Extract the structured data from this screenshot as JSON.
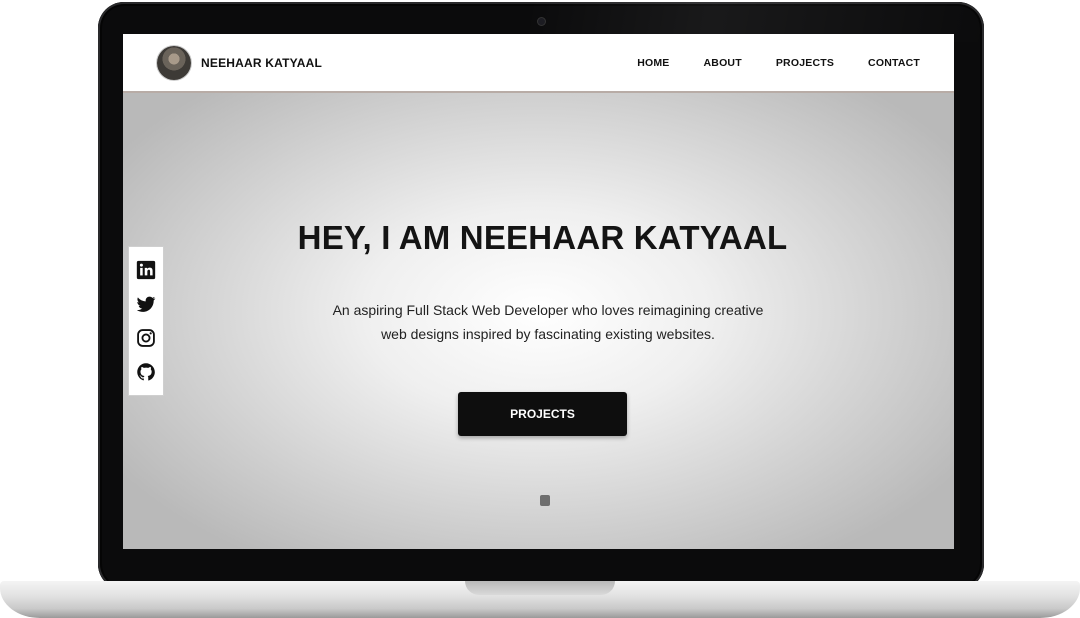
{
  "site": {
    "brand_name": "NEEHAAR KATYAAL",
    "nav": [
      {
        "label": "HOME"
      },
      {
        "label": "ABOUT"
      },
      {
        "label": "PROJECTS"
      },
      {
        "label": "CONTACT"
      }
    ]
  },
  "hero": {
    "title": "HEY, I AM NEEHAAR KATYAAL",
    "subtitle": "An aspiring Full Stack Web Developer who loves reimagining creative web designs inspired by fascinating existing websites.",
    "button_label": "PROJECTS"
  },
  "social": [
    {
      "icon": "linkedin-icon"
    },
    {
      "icon": "twitter-icon"
    },
    {
      "icon": "instagram-icon"
    },
    {
      "icon": "github-icon"
    }
  ],
  "colors": {
    "button_bg": "#0e0e0e",
    "nav_bg": "#ffffff",
    "hero_center": "#ffffff",
    "hero_edge": "#b9b9b9"
  }
}
